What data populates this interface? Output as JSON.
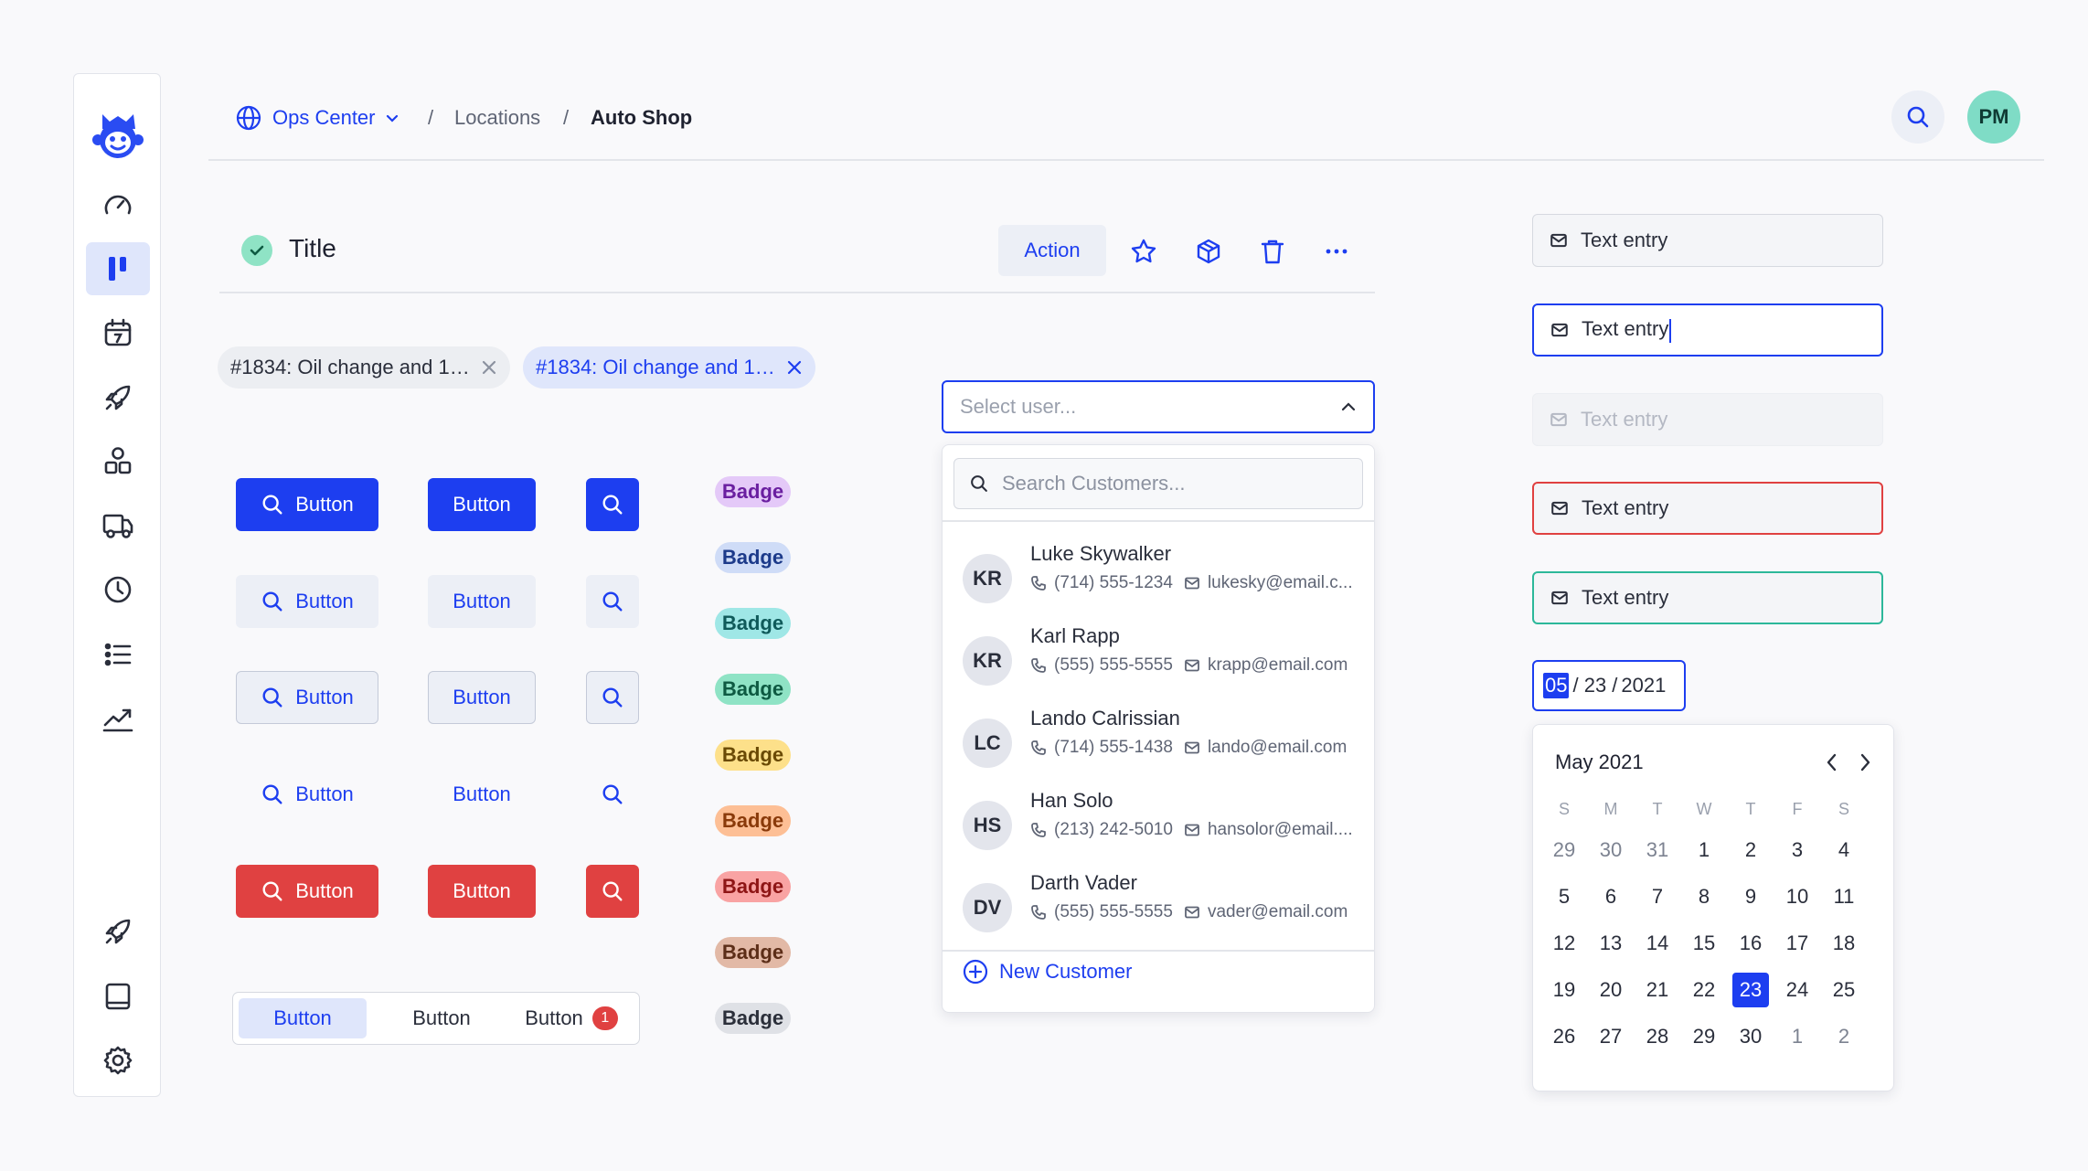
{
  "breadcrumb": {
    "org": "Ops Center",
    "sep1": "/",
    "locations": "Locations",
    "sep2": "/",
    "current": "Auto Shop"
  },
  "header": {
    "avatar_initials": "PM"
  },
  "titlebar": {
    "title": "Title",
    "action_label": "Action"
  },
  "chips": [
    {
      "label": "#1834: Oil change and 1…"
    },
    {
      "label": "#1834: Oil change and 1…"
    }
  ],
  "buttons": {
    "label": "Button"
  },
  "segmented": {
    "items": [
      "Button",
      "Button",
      "Button"
    ],
    "count": "1"
  },
  "badges": [
    {
      "label": "Badge",
      "bg": "#e4c9f8",
      "fg": "#6a1fa0"
    },
    {
      "label": "Badge",
      "bg": "#cfdcf7",
      "fg": "#1c3a8a"
    },
    {
      "label": "Badge",
      "bg": "#9fe7e6",
      "fg": "#0f5a5a"
    },
    {
      "label": "Badge",
      "bg": "#8fe3c5",
      "fg": "#0e5a42"
    },
    {
      "label": "Badge",
      "bg": "#fde08a",
      "fg": "#6a4a05"
    },
    {
      "label": "Badge",
      "bg": "#fdbf95",
      "fg": "#8a3a0a"
    },
    {
      "label": "Badge",
      "bg": "#f9a3a3",
      "fg": "#8e1515"
    },
    {
      "label": "Badge",
      "bg": "#e2b9a6",
      "fg": "#5c2e18"
    },
    {
      "label": "Badge",
      "bg": "#dfe1e6",
      "fg": "#2b2f3a"
    }
  ],
  "select": {
    "placeholder": "Select user...",
    "search_placeholder": "Search Customers..."
  },
  "customers": [
    {
      "initials": "KR",
      "name": "Luke Skywalker",
      "phone": "(714) 555-1234",
      "email": "lukesky@email.c..."
    },
    {
      "initials": "KR",
      "name": "Karl Rapp",
      "phone": "(555) 555-5555",
      "email": "krapp@email.com"
    },
    {
      "initials": "LC",
      "name": "Lando Calrissian",
      "phone": "(714) 555-1438",
      "email": "lando@email.com"
    },
    {
      "initials": "HS",
      "name": "Han Solo",
      "phone": "(213) 242-5010",
      "email": "hansolor@email...."
    },
    {
      "initials": "DV",
      "name": "Darth Vader",
      "phone": "(555) 555-5555",
      "email": "vader@email.com"
    }
  ],
  "new_customer_label": "New Customer",
  "text_entries": [
    {
      "value": "Text entry",
      "state": "default"
    },
    {
      "value": "Text entry",
      "state": "focused"
    },
    {
      "value": "Text entry",
      "state": "disabled"
    },
    {
      "value": "Text entry",
      "state": "error"
    },
    {
      "value": "Text entry",
      "state": "success"
    }
  ],
  "date_input": {
    "month": "05",
    "day": "/ 23 /",
    "year": "2021"
  },
  "calendar": {
    "title": "May 2021",
    "weekdays": [
      "S",
      "M",
      "T",
      "W",
      "T",
      "F",
      "S"
    ],
    "weeks": [
      [
        "29",
        "30",
        "31",
        "1",
        "2",
        "3",
        "4"
      ],
      [
        "5",
        "6",
        "7",
        "8",
        "9",
        "10",
        "11"
      ],
      [
        "12",
        "13",
        "14",
        "15",
        "16",
        "17",
        "18"
      ],
      [
        "19",
        "20",
        "21",
        "22",
        "23",
        "24",
        "25"
      ],
      [
        "26",
        "27",
        "28",
        "29",
        "30",
        "1",
        "2"
      ]
    ],
    "selected": "23"
  },
  "colors": {
    "primary": "#1d3ef0",
    "danger": "#e04141",
    "success": "#2cb89a",
    "avatar_bg": "#7fdcc6"
  },
  "icons": {
    "sidebar": [
      "logo-icon",
      "dashboard-icon",
      "board-icon",
      "calendar-icon",
      "rocket-icon",
      "shapes-icon",
      "truck-icon",
      "clock-icon",
      "list-icon",
      "trend-icon",
      "rocket-icon",
      "book-icon",
      "gear-icon"
    ]
  }
}
